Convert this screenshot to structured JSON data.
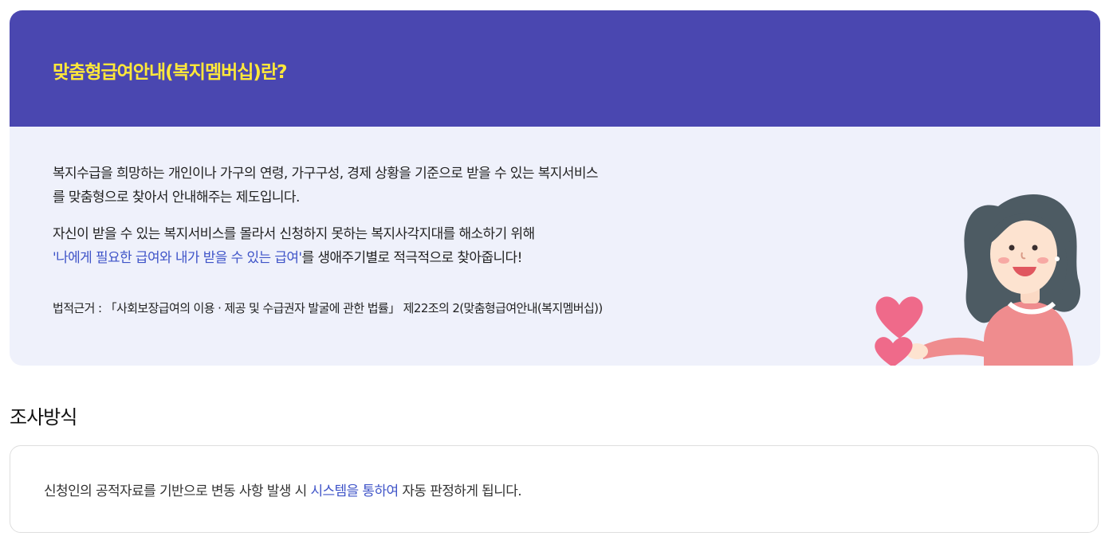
{
  "intro": {
    "title": "맞춤형급여안내(복지멤버십)란?",
    "para1_line1": "복지수급을 희망하는 개인이나 가구의 연령, 가구구성, 경제 상황을 기준으로 받을 수 있는 복지서비스",
    "para1_line2": "를 맞춤형으로 찾아서 안내해주는 제도입니다.",
    "para2_line1": "자신이 받을 수 있는 복지서비스를 몰라서 신청하지 못하는 복지사각지대를 해소하기 위해",
    "para2_highlight": "'나에게 필요한 급여와 내가 받을 수 있는 급여'",
    "para2_rest": "를 생애주기별로 적극적으로 찾아줍니다!",
    "legal": "법적근거 : 「사회보장급여의 이용 · 제공 및 수급권자 발굴에 관한 법률」 제22조의 2(맞춤형급여안내(복지멤버십))"
  },
  "method": {
    "section_title": "조사방식",
    "text_before": "신청인의 공적자료를 기반으로 변동 사항 발생 시 ",
    "text_highlight": "시스템을 통하여",
    "text_after": " 자동 판정하게 됩니다."
  },
  "colors": {
    "header_bg": "#4a47b0",
    "title_yellow": "#ffe83a",
    "card_bg": "#eff1fb",
    "highlight_blue": "#3f54c8"
  },
  "icons": {
    "illustration": "woman-holding-hearts-illustration"
  }
}
